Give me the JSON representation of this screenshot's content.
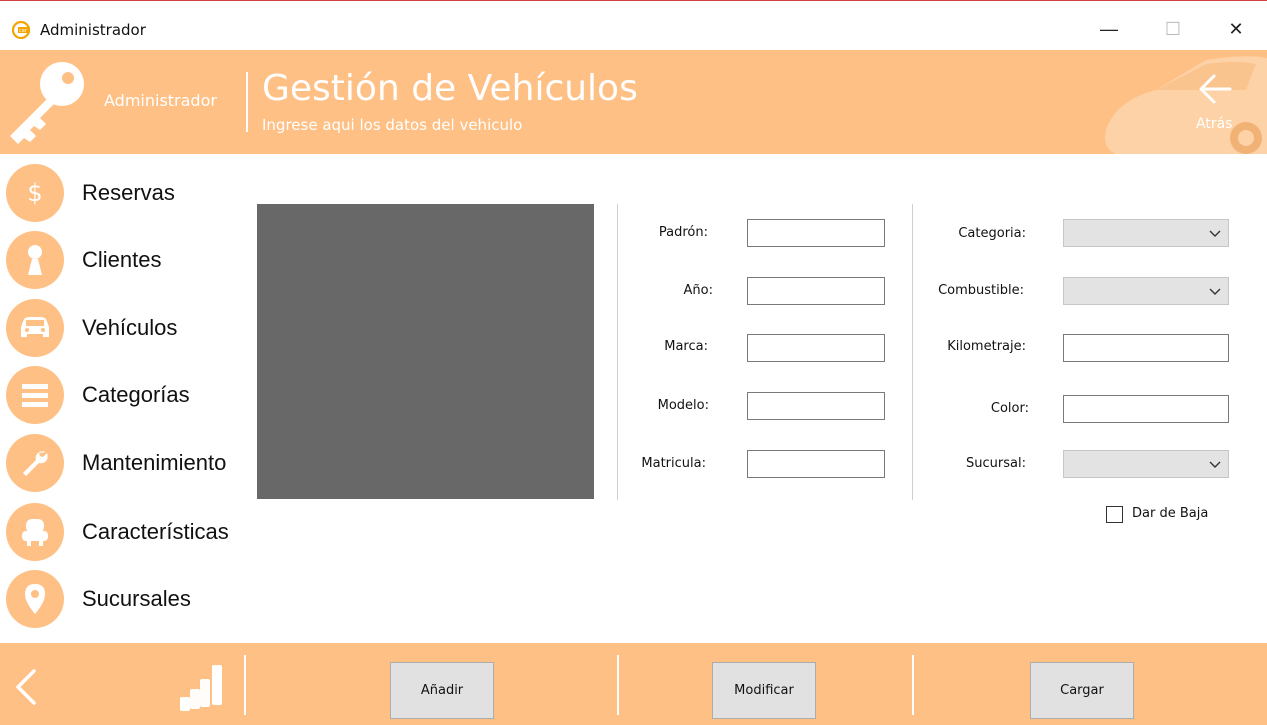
{
  "window": {
    "title": "Administrador",
    "minimize_glyph": "—",
    "maximize_glyph": "☐",
    "close_glyph": "✕"
  },
  "header": {
    "user_label": "Administrador",
    "title": "Gestión de Vehículos",
    "subtitle": "Ingrese aqui los datos del vehiculo",
    "back_label": "Atrás",
    "accent_color": "#fec085"
  },
  "sidebar": {
    "items": [
      {
        "label": "Reservas",
        "icon": "dollar-icon"
      },
      {
        "label": "Clientes",
        "icon": "person-icon"
      },
      {
        "label": "Vehículos",
        "icon": "car-icon"
      },
      {
        "label": "Categorías",
        "icon": "list-icon"
      },
      {
        "label": "Mantenimiento",
        "icon": "wrench-icon"
      },
      {
        "label": "Características",
        "icon": "seat-icon"
      },
      {
        "label": "Sucursales",
        "icon": "location-pin-icon"
      }
    ]
  },
  "form": {
    "left": {
      "padron_label": "Padrón:",
      "padron_value": "",
      "anio_label": "Año:",
      "anio_value": "",
      "marca_label": "Marca:",
      "marca_value": "",
      "modelo_label": "Modelo:",
      "modelo_value": "",
      "matricula_label": "Matricula:",
      "matricula_value": ""
    },
    "right": {
      "categoria_label": "Categoria:",
      "categoria_value": "",
      "combustible_label": "Combustible:",
      "combustible_value": "",
      "kilometraje_label": "Kilometraje:",
      "kilometraje_value": "",
      "color_label": "Color:",
      "color_value": "",
      "sucursal_label": "Sucursal:",
      "sucursal_value": ""
    },
    "dar_de_baja_label": "Dar de Baja",
    "dar_de_baja_checked": false
  },
  "footer": {
    "add_label": "Añadir",
    "modify_label": "Modificar",
    "load_label": "Cargar"
  }
}
